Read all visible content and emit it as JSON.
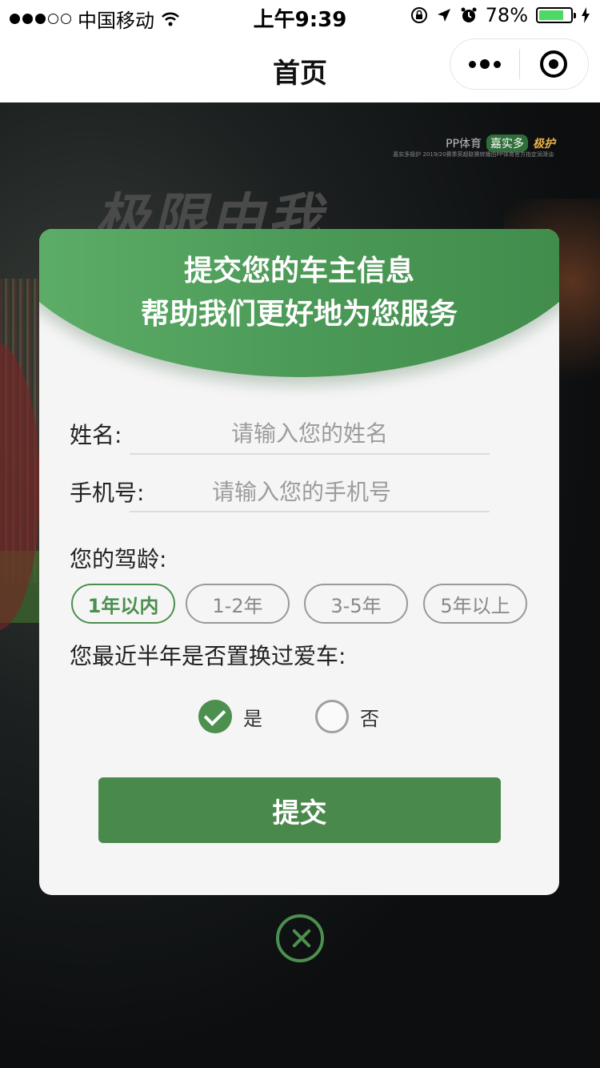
{
  "status_bar": {
    "carrier": "中国移动",
    "time": "上午9:39",
    "battery": "78%",
    "battery_level": 0.78
  },
  "nav": {
    "title": "首页"
  },
  "background": {
    "slogan": "极限由我",
    "brand_1": "PP体育",
    "brand_2": "嘉实多",
    "brand_3": "极护",
    "brand_sub": "嘉实多极护 2019/20赛季英超联赛转播由PP体育官方指定润滑油"
  },
  "form": {
    "header_line1": "提交您的车主信息",
    "header_line2": "帮助我们更好地为您服务",
    "name_label": "姓名:",
    "name_placeholder": "请输入您的姓名",
    "phone_label": "手机号:",
    "phone_placeholder": "请输入您的手机号",
    "driving_age_label": "您的驾龄:",
    "driving_age_options": [
      "1年以内",
      "1-2年",
      "3-5年",
      "5年以上"
    ],
    "driving_age_selected": "1年以内",
    "car_change_question": "您最近半年是否置换过爱车:",
    "yes_label": "是",
    "no_label": "否",
    "selected": "是",
    "submit_label": "提交"
  },
  "colors": {
    "accent": "#4c8f4f",
    "header_green": "#4c9a57"
  }
}
